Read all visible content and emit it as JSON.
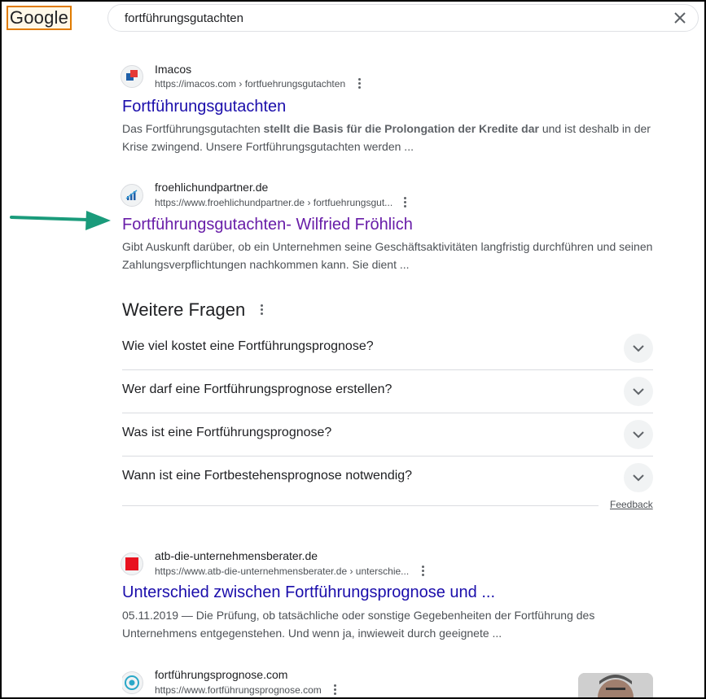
{
  "header": {
    "logo_text": "Google",
    "search_value": "fortführungsgutachten"
  },
  "results": [
    {
      "site": "Imacos",
      "url": "https://imacos.com › fortfuehrungsgutachten",
      "title": "Fortführungsgutachten",
      "snippet_pre": "Das Fortführungsgutachten ",
      "snippet_bold": "stellt die Basis für die Prolongation der Kredite dar",
      "snippet_post": " und ist deshalb in der Krise zwingend. Unsere Fortführungsgutachten werden ..."
    },
    {
      "site": "froehlichundpartner.de",
      "url": "https://www.froehlichundpartner.de › fortfuehrungsgut...",
      "title": "Fortführungsgutachten- Wilfried Fröhlich",
      "snippet": "Gibt Auskunft darüber, ob ein Unternehmen seine Geschäftsaktivitäten langfristig durchführen und seinen Zahlungsverpflichtungen nachkommen kann. Sie dient ..."
    },
    {
      "site": "atb-die-unternehmensberater.de",
      "url": "https://www.atb-die-unternehmensberater.de › unterschie...",
      "title": "Unterschied zwischen Fortführungsprognose und ...",
      "snippet": "05.11.2019 — Die Prüfung, ob tatsächliche oder sonstige Gegebenheiten der Fortführung des Unternehmens entgegenstehen. Und wenn ja, inwieweit durch geeignete ..."
    },
    {
      "site": "fortführungsprognose.com",
      "url": "https://www.fortführungsprognose.com"
    }
  ],
  "paa": {
    "heading": "Weitere Fragen",
    "questions": [
      "Wie viel kostet eine Fortführungsprognose?",
      "Wer darf eine Fortführungsprognose erstellen?",
      "Was ist eine Fortführungsprognose?",
      "Wann ist eine Fortbestehensprognose notwendig?"
    ],
    "feedback": "Feedback"
  },
  "colors": {
    "link": "#1a0dab",
    "visited": "#681da8",
    "annotation_arrow": "#1a9b7b"
  }
}
